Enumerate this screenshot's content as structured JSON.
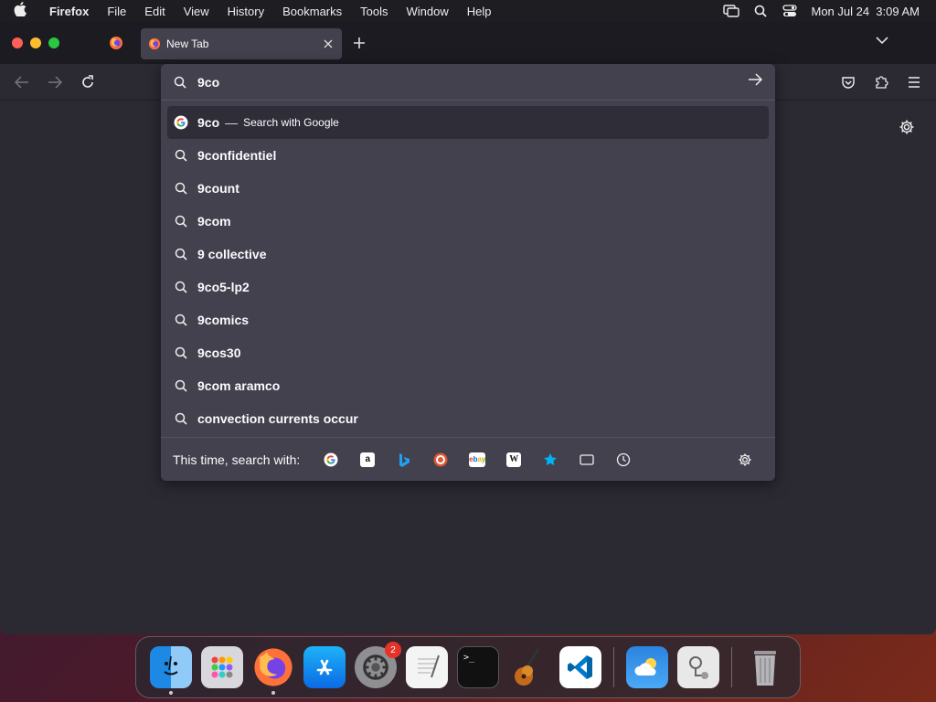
{
  "menubar": {
    "app": "Firefox",
    "items": [
      "File",
      "Edit",
      "View",
      "History",
      "Bookmarks",
      "Tools",
      "Window",
      "Help"
    ],
    "clock": "Mon Jul 24  3:09 AM"
  },
  "tabs": {
    "active_title": "New Tab"
  },
  "urlbar": {
    "value": "9co",
    "first_result": {
      "query": "9co",
      "separator": "—",
      "action": "Search with Google"
    },
    "suggestions": [
      "9confidentiel",
      "9count",
      "9com",
      "9 collective",
      "9co5-lp2",
      "9comics",
      "9cos30",
      "9com aramco",
      "convection currents occur"
    ],
    "search_with_label": "This time, search with:",
    "engines": [
      "google-icon",
      "amazon-icon",
      "bing-icon",
      "duckduckgo-icon",
      "ebay-icon",
      "wikipedia-icon",
      "bookmarks-icon",
      "tabs-icon",
      "history-icon"
    ]
  },
  "dock": {
    "apps": [
      "Finder",
      "Launchpad",
      "Firefox",
      "App Store",
      "System Settings",
      "TextEdit",
      "Terminal",
      "GarageBand",
      "Visual Studio Code",
      "Weather",
      "Disk Utility",
      "Trash"
    ],
    "settings_badge": "2"
  },
  "colors": {
    "window_bg": "#2b2a33",
    "tabbar_bg": "#1c1b22",
    "popup_bg": "#42414d",
    "selected_row": "#2f2e38",
    "text": "#fbfbfe"
  }
}
